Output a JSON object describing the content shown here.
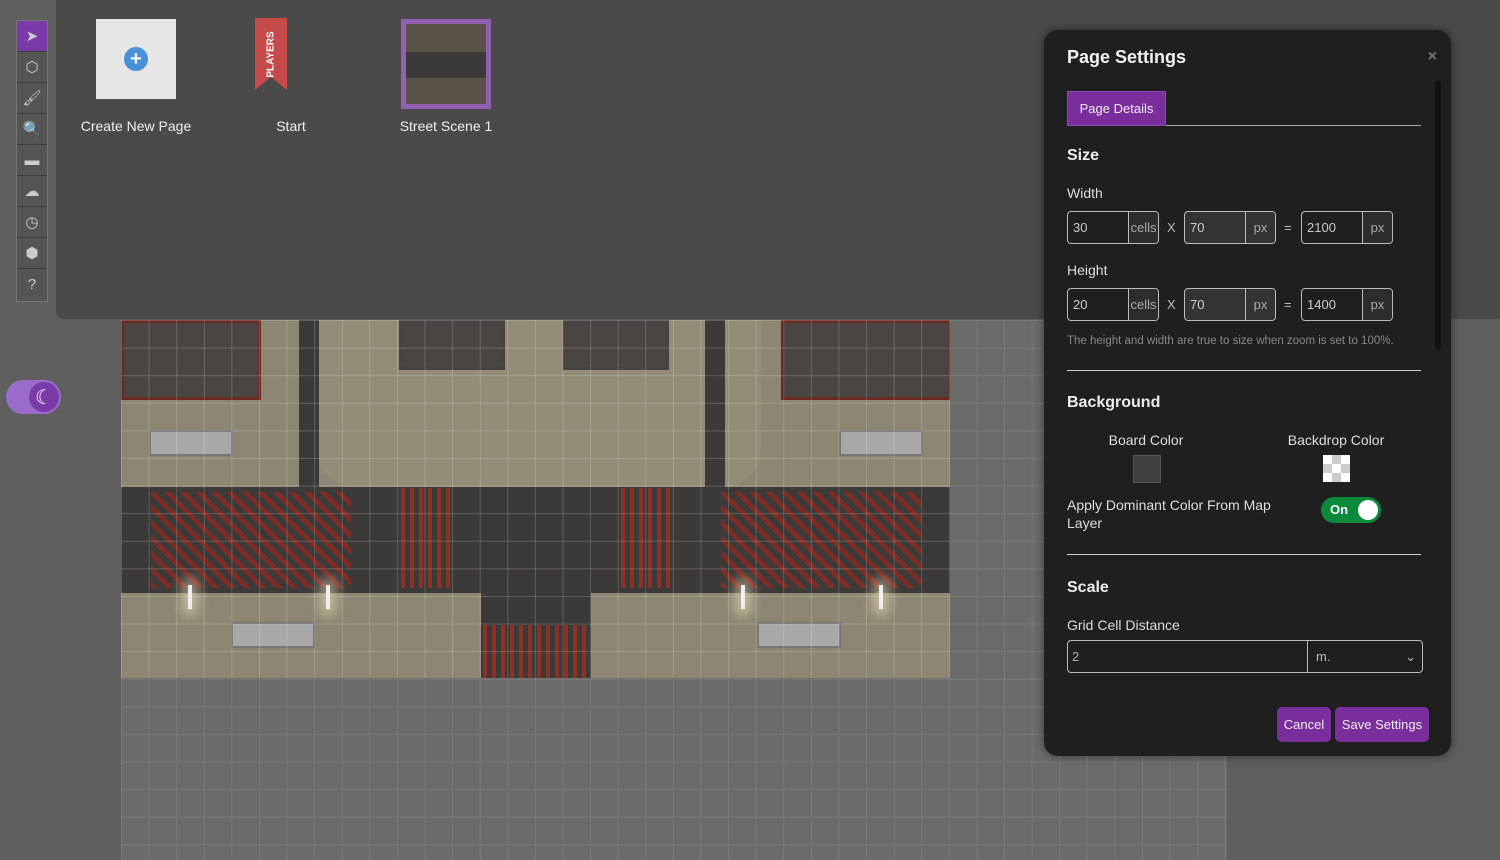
{
  "toolbar": {
    "tools": [
      {
        "name": "select",
        "icon": "cursor-icon",
        "active": true
      },
      {
        "name": "objects",
        "icon": "cube-icon"
      },
      {
        "name": "draw",
        "icon": "brush-icon"
      },
      {
        "name": "zoom",
        "icon": "magnifier-icon"
      },
      {
        "name": "measure",
        "icon": "ruler-icon"
      },
      {
        "name": "fog",
        "icon": "cloud-icon"
      },
      {
        "name": "turn-tracker",
        "icon": "clock-icon"
      },
      {
        "name": "dice",
        "icon": "d20-icon"
      },
      {
        "name": "help",
        "icon": "question-icon"
      }
    ]
  },
  "pages": {
    "create_label": "Create New Page",
    "start_label": "Start",
    "players_ribbon": "PLAYERS",
    "scene_label": "Street Scene 1"
  },
  "dialog": {
    "title": "Page Settings",
    "close": "×",
    "tab": "Page Details",
    "size_heading": "Size",
    "width_label": "Width",
    "width_cells": "30",
    "cells_unit": "cells",
    "times": "X",
    "cell_px": "70",
    "px_unit": "px",
    "equals": "=",
    "width_px": "2100",
    "height_label": "Height",
    "height_cells": "20",
    "height_cell_px": "70",
    "height_px": "1400",
    "hint": "The height and width are true to size when zoom is set to 100%.",
    "background_heading": "Background",
    "board_color_label": "Board Color",
    "board_color": "#3f3f3f",
    "backdrop_color_label": "Backdrop Color",
    "dominant_label": "Apply Dominant Color From Map Layer",
    "dominant_toggle": "On",
    "scale_heading": "Scale",
    "grid_distance_label": "Grid Cell Distance",
    "grid_distance": "2",
    "grid_unit": "m.",
    "cancel": "Cancel",
    "save": "Save Settings"
  },
  "colors": {
    "accent": "#7a2e9c",
    "toggle_on": "#0a8a3a"
  }
}
